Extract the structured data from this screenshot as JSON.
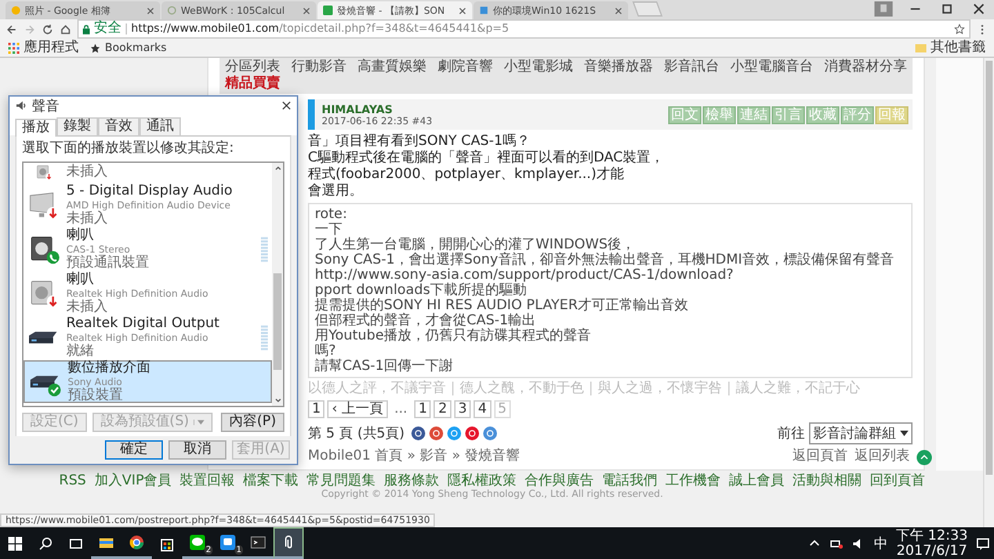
{
  "browser": {
    "tabs": [
      {
        "title": "照片 - Google 相簿",
        "selected": false,
        "kind": "photos"
      },
      {
        "title": "WeBWorK : 105Calcul",
        "selected": false,
        "kind": "webwork"
      },
      {
        "title": "發燒音響 - 【請教】SON",
        "selected": true,
        "kind": "mobile01"
      },
      {
        "title": "你的環境Win10 1621S",
        "selected": false,
        "kind": "page"
      }
    ],
    "secure_label": "安全",
    "url_host": "https://www.mobile01.com",
    "url_path": "/topicdetail.php?f=348&t=4645441&p=5",
    "bookmarks": [
      {
        "label": "應用程式",
        "kind": "apps"
      },
      {
        "label": "Bookmarks",
        "kind": "star"
      }
    ],
    "other_bookmarks": "其他書籤"
  },
  "page": {
    "nav": [
      {
        "label": "分區列表",
        "highlighted": false
      },
      {
        "label": "行動影音",
        "highlighted": false
      },
      {
        "label": "高畫質娛樂",
        "highlighted": false
      },
      {
        "label": "劇院音響",
        "highlighted": false
      },
      {
        "label": "小型電影城",
        "highlighted": false
      },
      {
        "label": "音樂播放器",
        "highlighted": false
      },
      {
        "label": "影音訊台",
        "highlighted": false
      },
      {
        "label": "小型電腦音台",
        "highlighted": false
      },
      {
        "label": "消費器材分享",
        "highlighted": false
      },
      {
        "label": "精品買賣",
        "highlighted": true
      }
    ],
    "post": {
      "author": "HIMALAYAS",
      "meta": "2017-06-16 22:35 #43",
      "actions": [
        {
          "label": "回文",
          "highlighted": false
        },
        {
          "label": "檢舉",
          "highlighted": false
        },
        {
          "label": "連結",
          "highlighted": false
        },
        {
          "label": "引言",
          "highlighted": false
        },
        {
          "label": "收藏",
          "highlighted": false
        },
        {
          "label": "評分",
          "highlighted": false
        },
        {
          "label": "回報",
          "highlighted": true
        }
      ],
      "lines": [
        "音」項目裡有看到SONY CAS-1嗎？",
        "C驅動程式後在電腦的「聲音」裡面可以看的到DAC裝置，",
        "程式(foobar2000、potplayer、kmplayer...)才能",
        "會選用。"
      ],
      "quote_lines": [
        "rote:",
        "一下",
        "了人生第一台電腦，開開心心的灌了WINDOWS後，",
        "Sony CAS-1，會出選擇Sony音訊，卻音外無法輸出聲音，耳機HDMI音效，標設備保留有聲音",
        "http://www.sony-asia.com/support/product/CAS-1/download?",
        "pport downloads下載所提的驅動",
        "提需提供的SONY HI RES AUDIO PLAYER才可正常輸出音效",
        "但部程式的聲音，才會從CAS-1輸出",
        "用Youtube播放，仍舊只有訪碟其程式的聲音",
        "嗎?",
        "請幫CAS-1回傳一下謝"
      ],
      "signature": "以德人之評，不議宇音｜德人之醜，不動于色｜與人之過，不懷宇咎｜議人之難，不記于心"
    },
    "pagination": {
      "first": "1",
      "prev": "‹ 上一頁",
      "ellipsis": "...",
      "pages": [
        {
          "label": "1",
          "selected": false
        },
        {
          "label": "2",
          "selected": false
        },
        {
          "label": "3",
          "selected": false
        },
        {
          "label": "4",
          "selected": false
        },
        {
          "label": "5",
          "selected": true
        }
      ]
    },
    "page_count": "第 5 頁 (共5頁)",
    "goto_label": "前往",
    "goto_select": "影音討論群組",
    "breadcrumb": "Mobile01 首頁 » 影音 » 發燒音響",
    "bottom_links": [
      "返回頁首",
      "返回列表"
    ],
    "site_links": [
      "RSS",
      "加入VIP會員",
      "裝置回報",
      "檔案下載",
      "常見問題集",
      "服務條款",
      "隱私權政策",
      "合作與廣告",
      "電話我們",
      "工作機會",
      "誠上會員",
      "活動與相關",
      "回到頁首"
    ],
    "copyright": "Copyright © 2014 Yong Sheng Technology Co., Ltd. All rights reserved."
  },
  "status_url": "https://www.mobile01.com/postreport.php?f=348&t=4645441&p=5&postid=64751930",
  "dialog": {
    "title": "聲音",
    "tabs": [
      {
        "label": "播放",
        "selected": true
      },
      {
        "label": "錄製",
        "selected": false
      },
      {
        "label": "音效",
        "selected": false
      },
      {
        "label": "通訊",
        "selected": false
      }
    ],
    "instruction": "選取下面的播放裝置以修改其設定:",
    "devices": [
      {
        "status": "未插入",
        "kind": "speaker",
        "plugged_in": false,
        "default_device": false,
        "default_comm": false,
        "selected": false,
        "meter": false
      },
      {
        "name": "5 - Digital Display Audio",
        "driver": "AMD High Definition Audio Device",
        "status": "未插入",
        "kind": "monitor",
        "plugged_in": false,
        "default_device": false,
        "default_comm": false,
        "selected": false,
        "meter": false
      },
      {
        "name": "喇叭",
        "driver": "CAS-1 Stereo",
        "status": "預設通訊裝置",
        "kind": "speaker_dark",
        "plugged_in": true,
        "default_device": false,
        "default_comm": true,
        "selected": false,
        "meter": true
      },
      {
        "name": "喇叭",
        "driver": "Realtek High Definition Audio",
        "status": "未插入",
        "kind": "speaker",
        "plugged_in": false,
        "default_device": false,
        "default_comm": false,
        "selected": false,
        "meter": false
      },
      {
        "name": "Realtek Digital Output",
        "driver": "Realtek High Definition Audio",
        "status": "就緒",
        "kind": "receiver",
        "plugged_in": true,
        "default_device": false,
        "default_comm": false,
        "selected": false,
        "meter": true
      },
      {
        "name": "數位播放介面",
        "driver": "Sony Audio",
        "status": "預設裝置",
        "kind": "receiver",
        "plugged_in": true,
        "default_device": true,
        "default_comm": false,
        "selected": true,
        "meter": false
      }
    ],
    "device_buttons": [
      {
        "label": "設定(C)",
        "disabled": true,
        "split": false
      },
      {
        "label": "設為預設值(S)",
        "disabled": true,
        "split": true
      },
      {
        "label": "內容(P)",
        "disabled": false,
        "split": false
      }
    ],
    "footer_buttons": [
      {
        "label": "確定",
        "disabled": false,
        "focused": true
      },
      {
        "label": "取消",
        "disabled": false,
        "focused": false
      },
      {
        "label": "套用(A)",
        "disabled": true,
        "focused": false
      }
    ]
  },
  "taskbar": {
    "apps": [
      {
        "kind": "explorer",
        "running": true,
        "active": false
      },
      {
        "kind": "chrome",
        "running": true,
        "active": false
      },
      {
        "kind": "store",
        "running": false,
        "active": false
      },
      {
        "kind": "chat",
        "running": true,
        "active": false,
        "badge": "2"
      },
      {
        "kind": "messenger",
        "running": true,
        "active": false,
        "badge": "1"
      },
      {
        "kind": "terminal",
        "running": true,
        "active": false
      },
      {
        "kind": "clip",
        "running": true,
        "active": true
      }
    ],
    "ime": "中",
    "time": "下午 12:33",
    "date": "2017/6/17"
  }
}
